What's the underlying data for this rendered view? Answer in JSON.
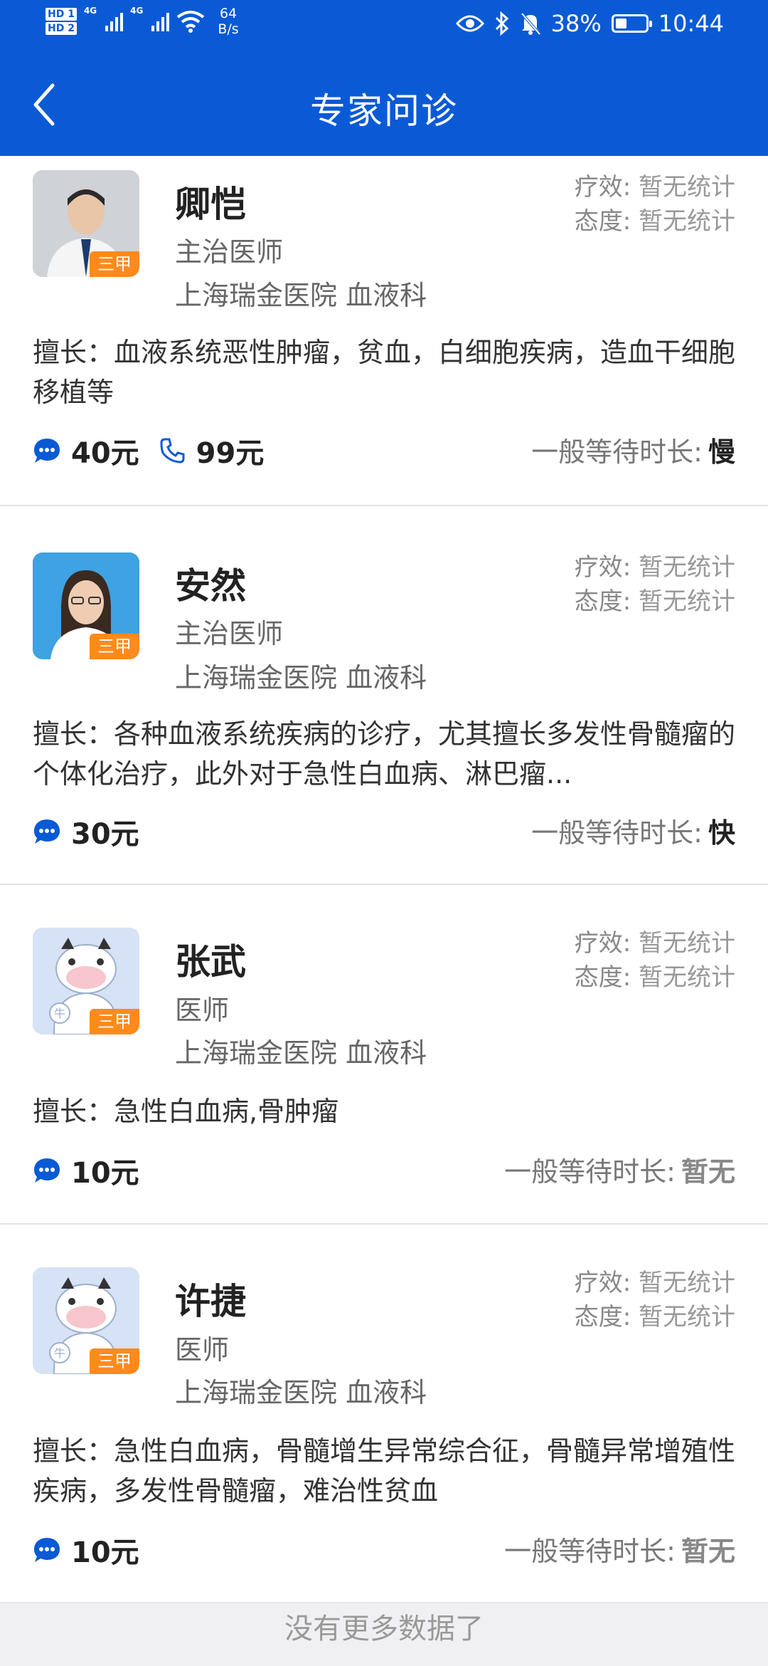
{
  "status_bar": {
    "hd1": "HD 1",
    "hd2": "HD 2",
    "net1": "4G",
    "net2": "4G",
    "speed_value": "64",
    "speed_unit": "B/s",
    "battery": "38%",
    "battery_level": 0.38,
    "time": "10:44",
    "icons": [
      "eye-icon",
      "bluetooth-icon",
      "mute-bell-icon",
      "wifi-icon",
      "signal-icon",
      "battery-icon"
    ]
  },
  "header": {
    "title": "专家问诊",
    "back_icon": "chevron-left-icon"
  },
  "labels": {
    "efficacy": "疗效:",
    "attitude": "态度:",
    "wait": "一般等待时长:"
  },
  "colors": {
    "brand": "#0a5ad6",
    "badge": "#ff8a1c"
  },
  "doctors": [
    {
      "name": "卿恺",
      "title": "主治医师",
      "hospital": "上海瑞金医院 血液科",
      "badge": "三甲",
      "efficacy": "暂无统计",
      "attitude": "暂无统计",
      "specialty": "擅长：血液系统恶性肿瘤，贫血，白细胞疾病，造血干细胞移植等",
      "chat_price": "40元",
      "phone_price": "99元",
      "wait": "慢"
    },
    {
      "name": "安然",
      "title": "主治医师",
      "hospital": "上海瑞金医院 血液科",
      "badge": "三甲",
      "efficacy": "暂无统计",
      "attitude": "暂无统计",
      "specialty": "擅长：各种血液系统疾病的诊疗，尤其擅长多发性骨髓瘤的个体化治疗，此外对于急性白血病、淋巴瘤...",
      "chat_price": "30元",
      "wait": "快"
    },
    {
      "name": "张武",
      "title": "医师",
      "hospital": "上海瑞金医院 血液科",
      "badge": "三甲",
      "efficacy": "暂无统计",
      "attitude": "暂无统计",
      "specialty": "擅长：急性白血病,骨肿瘤",
      "chat_price": "10元",
      "wait": "暂无"
    },
    {
      "name": "许捷",
      "title": "医师",
      "hospital": "上海瑞金医院 血液科",
      "badge": "三甲",
      "efficacy": "暂无统计",
      "attitude": "暂无统计",
      "specialty": "擅长：急性白血病，骨髓增生异常综合征，骨髓异常增殖性疾病，多发性骨髓瘤，难治性贫血",
      "chat_price": "10元",
      "wait": "暂无"
    }
  ],
  "footer": {
    "text": "没有更多数据了"
  }
}
